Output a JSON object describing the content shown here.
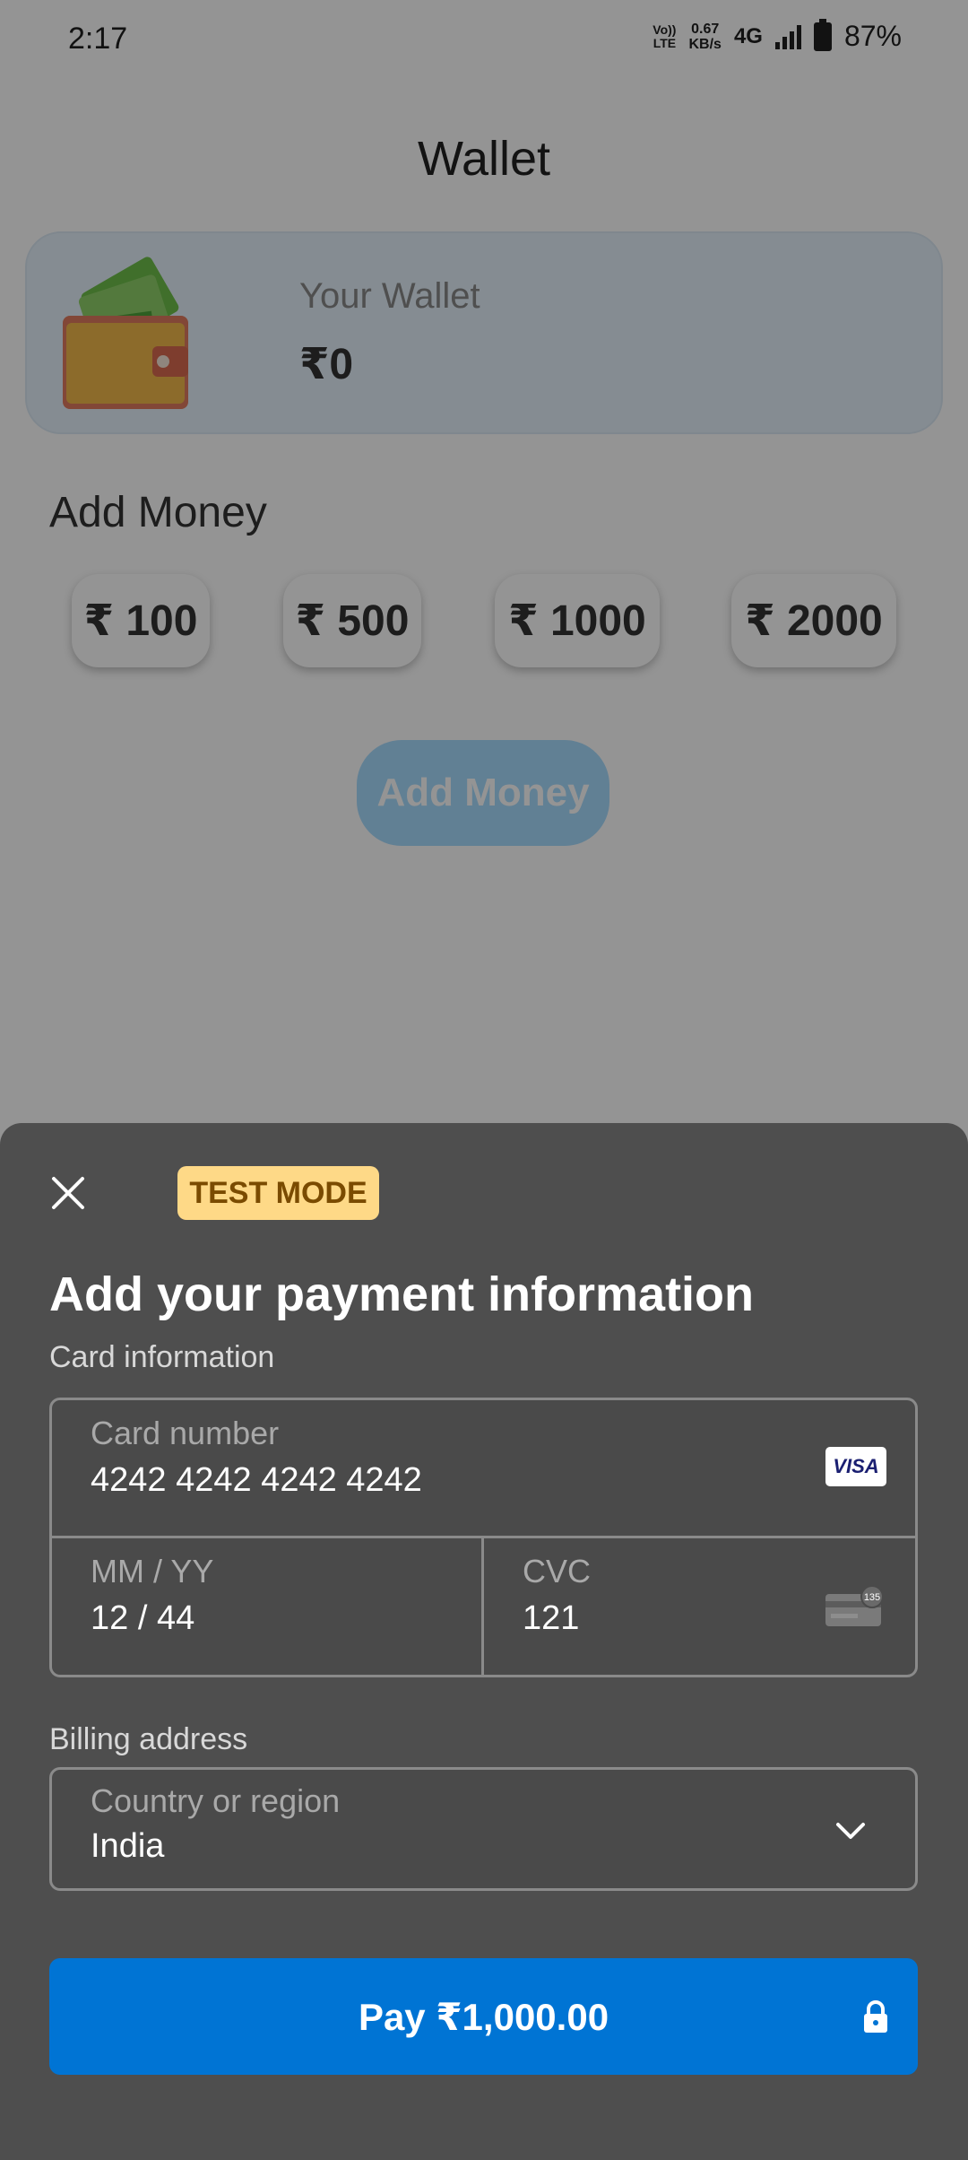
{
  "status_bar": {
    "time": "2:17",
    "volte": "Vo) LTE",
    "volte_top": "Vo))",
    "volte_bottom": "LTE",
    "speed_value": "0.67",
    "speed_unit": "KB/s",
    "network": "4G",
    "battery": "87%"
  },
  "page": {
    "title": "Wallet",
    "wallet_label": "Your Wallet",
    "wallet_amount": "₹0",
    "add_money_heading": "Add Money",
    "amount_options": [
      "₹ 100",
      "₹ 500",
      "₹ 1000",
      "₹ 2000"
    ],
    "add_money_button": "Add Money"
  },
  "sheet": {
    "badge": "TEST MODE",
    "title": "Add your payment information",
    "card_info_label": "Card information",
    "card_number": {
      "placeholder": "Card number",
      "value": "4242 4242 4242 4242",
      "brand": "VISA"
    },
    "expiry": {
      "placeholder": "MM / YY",
      "value": "12 / 44"
    },
    "cvc": {
      "placeholder": "CVC",
      "value": "121",
      "hint": "135"
    },
    "billing_label": "Billing address",
    "country": {
      "placeholder": "Country or region",
      "value": "India"
    },
    "pay_button": "Pay ₹1,000.00"
  },
  "colors": {
    "sheet_bg": "#4e4e4e",
    "pay_button": "#0074d4",
    "badge_bg": "#fed987",
    "badge_text": "#7a4b00",
    "add_money_button": "#a8dcff",
    "wallet_card_bg": "#e6f2fb"
  },
  "icons": [
    "close-icon",
    "visa-card-icon",
    "cvc-card-icon",
    "chevron-down-icon",
    "lock-icon",
    "wallet-icon",
    "signal-icon",
    "battery-icon"
  ]
}
